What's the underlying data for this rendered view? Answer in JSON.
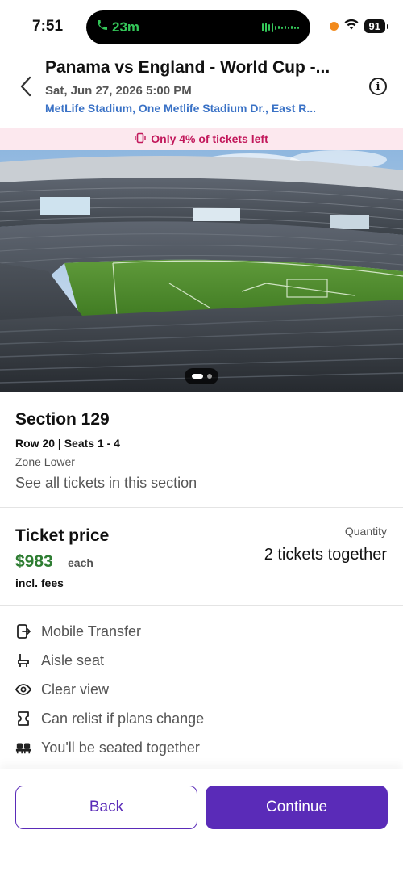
{
  "status_bar": {
    "time": "7:51",
    "call_duration": "23m",
    "battery": "91"
  },
  "header": {
    "title": "Panama vs England - World Cup -...",
    "datetime": "Sat, Jun 27, 2026 5:00 PM",
    "venue": "MetLife Stadium, One Metlife Stadium Dr., East R..."
  },
  "banner": {
    "text": "Only 4% of tickets left"
  },
  "gallery": {
    "page_count": 2,
    "current_page": 1
  },
  "section": {
    "title": "Section 129",
    "row_seats": "Row 20 | Seats 1 - 4",
    "zone": "Zone Lower",
    "link": "See all tickets in this section"
  },
  "price": {
    "label": "Ticket price",
    "value": "$983",
    "each": "each",
    "fees": "incl. fees",
    "quantity_label": "Quantity",
    "quantity_value": "2 tickets together"
  },
  "features": [
    {
      "label": "Mobile Transfer",
      "icon": "mobile-transfer-icon"
    },
    {
      "label": "Aisle seat",
      "icon": "aisle-seat-icon"
    },
    {
      "label": "Clear view",
      "icon": "eye-icon"
    },
    {
      "label": "Can relist if plans change",
      "icon": "ticket-icon"
    },
    {
      "label": "You'll be seated together",
      "icon": "seats-together-icon"
    }
  ],
  "buttons": {
    "back": "Back",
    "continue": "Continue"
  },
  "colors": {
    "accent": "#5a2bb8",
    "price_green": "#2e7d32",
    "banner_text": "#c2185b",
    "banner_bg": "#fce8ee",
    "link_blue": "#3a72c6"
  }
}
